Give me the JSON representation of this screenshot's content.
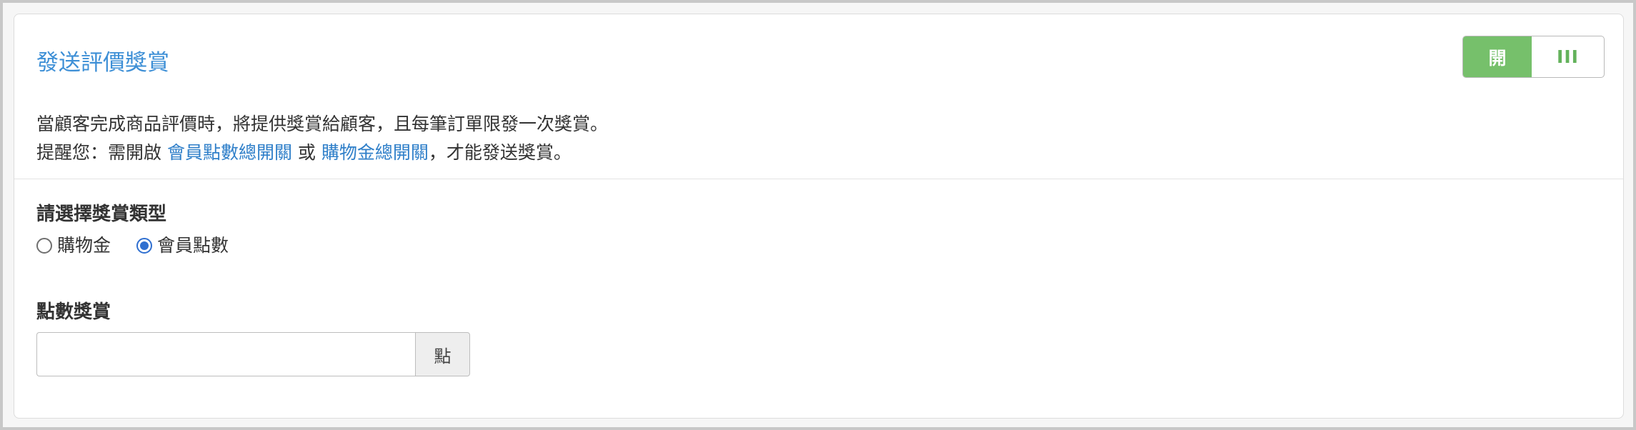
{
  "section": {
    "title": "發送評價獎賞",
    "toggle": {
      "on_label": "開",
      "off_label": "III",
      "state": "on"
    },
    "description": {
      "line1": "當顧客完成商品評價時，將提供獎賞給顧客，且每筆訂單限發一次獎賞。",
      "line2_prefix": "提醒您：需開啟 ",
      "link1": "會員點數總開關",
      "line2_middle": " 或 ",
      "link2": "購物金總開關",
      "line2_suffix": "，才能發送獎賞。"
    }
  },
  "reward_type": {
    "label": "請選擇獎賞類型",
    "options": [
      {
        "label": "購物金",
        "checked": false
      },
      {
        "label": "會員點數",
        "checked": true
      }
    ]
  },
  "points_reward": {
    "label": "點數獎賞",
    "value": "",
    "placeholder": "",
    "unit": "點"
  },
  "colors": {
    "accent_blue": "#3d8fd6",
    "link_blue": "#2f7fc9",
    "toggle_green": "#76c06b",
    "radio_blue": "#2f6fd0"
  }
}
